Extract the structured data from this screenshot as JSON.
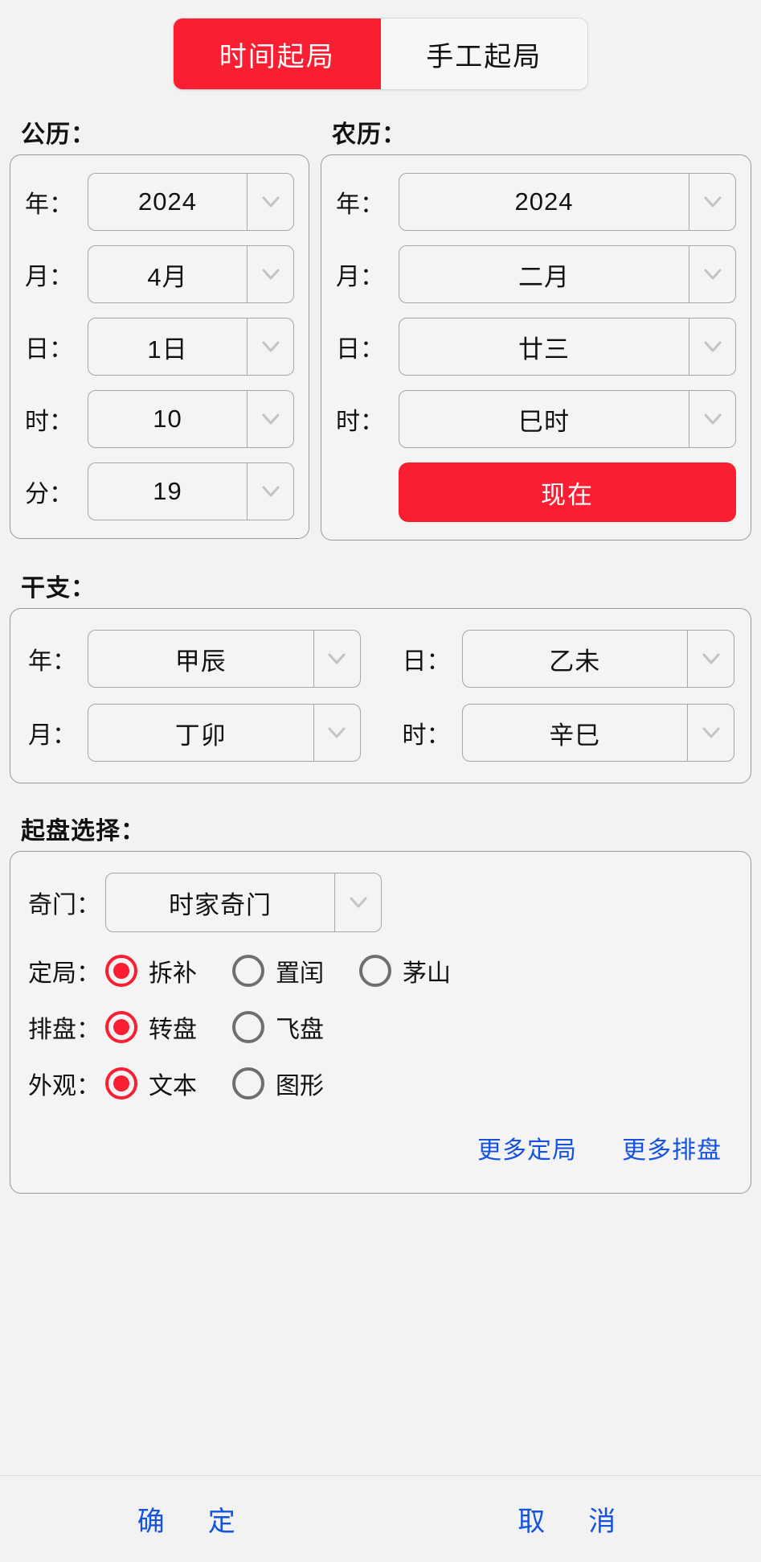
{
  "tabs": [
    {
      "label": "时间起局",
      "active": true
    },
    {
      "label": "手工起局",
      "active": false
    }
  ],
  "solar": {
    "section_label": "公历：",
    "rows": [
      {
        "label": "年：",
        "value": "2024"
      },
      {
        "label": "月：",
        "value": "4月"
      },
      {
        "label": "日：",
        "value": "1日"
      },
      {
        "label": "时：",
        "value": "10"
      },
      {
        "label": "分：",
        "value": "19"
      }
    ]
  },
  "lunar": {
    "section_label": "农历：",
    "rows": [
      {
        "label": "年：",
        "value": "2024"
      },
      {
        "label": "月：",
        "value": "二月"
      },
      {
        "label": "日：",
        "value": "廿三"
      },
      {
        "label": "时：",
        "value": "巳时"
      }
    ],
    "now_button": "现在"
  },
  "ganzhi": {
    "section_label": "干支：",
    "cells": [
      {
        "label": "年：",
        "value": "甲辰"
      },
      {
        "label": "日：",
        "value": "乙未"
      },
      {
        "label": "月：",
        "value": "丁卯"
      },
      {
        "label": "时：",
        "value": "辛巳"
      }
    ]
  },
  "qipan": {
    "section_label": "起盘选择：",
    "qimen": {
      "label": "奇门：",
      "value": "时家奇门"
    },
    "radio_groups": [
      {
        "label": "定局：",
        "options": [
          {
            "text": "拆补",
            "selected": true
          },
          {
            "text": "置闰",
            "selected": false
          },
          {
            "text": "茅山",
            "selected": false
          }
        ]
      },
      {
        "label": "排盘：",
        "options": [
          {
            "text": "转盘",
            "selected": true
          },
          {
            "text": "飞盘",
            "selected": false
          }
        ]
      },
      {
        "label": "外观：",
        "options": [
          {
            "text": "文本",
            "selected": true
          },
          {
            "text": "图形",
            "selected": false
          }
        ]
      }
    ],
    "links": [
      {
        "text": "更多定局"
      },
      {
        "text": "更多排盘"
      }
    ]
  },
  "footer": {
    "confirm": "确　定",
    "cancel": "取　消"
  },
  "colors": {
    "accent_red": "#FA1E32",
    "link_blue": "#1552E0",
    "page_bg": "#F2F2F2",
    "card_border": "#9A9A9A"
  }
}
